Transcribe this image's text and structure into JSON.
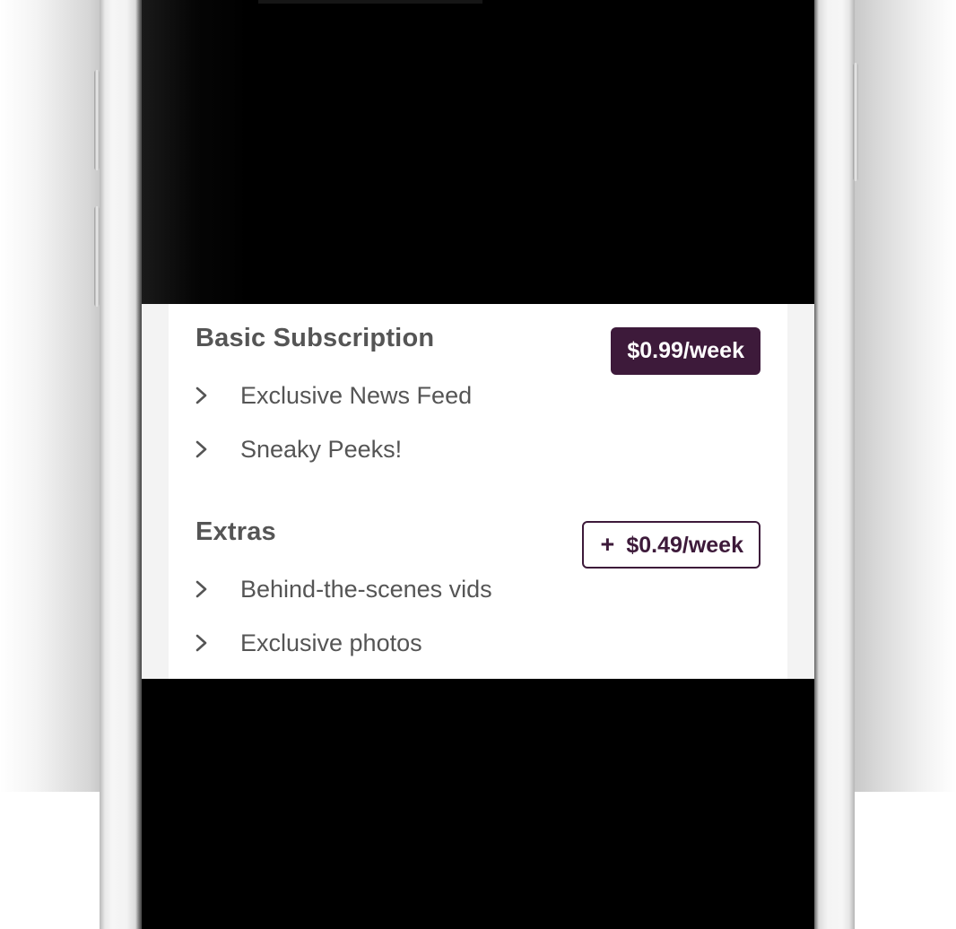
{
  "colors": {
    "accent": "#3d1a3a",
    "text": "#555555",
    "screen_background": "#000000",
    "card_background": "#ffffff"
  },
  "basic": {
    "title": "Basic Subscription",
    "price": "$0.99/week",
    "features": [
      {
        "icon": "chevron-right-icon",
        "label": "Exclusive News Feed"
      },
      {
        "icon": "chevron-right-icon",
        "label": "Sneaky Peeks!"
      }
    ]
  },
  "extras": {
    "title": "Extras",
    "add_button": {
      "icon": "plus-icon",
      "symbol": "+",
      "price": "$0.49/week"
    },
    "features": [
      {
        "icon": "chevron-right-icon",
        "label": "Behind-the-scenes vids"
      },
      {
        "icon": "chevron-right-icon",
        "label": "Exclusive photos"
      }
    ]
  }
}
